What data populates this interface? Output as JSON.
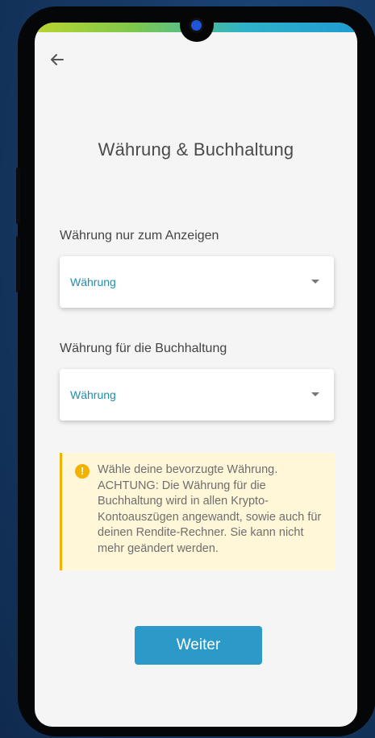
{
  "header": {
    "back_icon": "arrow-left-icon"
  },
  "page": {
    "title": "Währung & Buchhaltung"
  },
  "display_currency": {
    "label": "Währung nur zum Anzeigen",
    "value": "Währung"
  },
  "accounting_currency": {
    "label": "Währung für die Buchhaltung",
    "value": "Währung"
  },
  "alert": {
    "icon": "exclamation-icon",
    "text": "Wähle deine bevorzugte Währung. ACHTUNG: Die Währung für die Buchhaltung wird in allen Krypto-Kontoauszügen angewandt, sowie auch für deinen Rendite-Rechner. Sie kann nicht mehr geändert werden."
  },
  "footer": {
    "next_label": "Weiter"
  },
  "colors": {
    "accent": "#2c9ac8",
    "warning": "#f2b200",
    "warning_bg": "#fff7d8"
  }
}
